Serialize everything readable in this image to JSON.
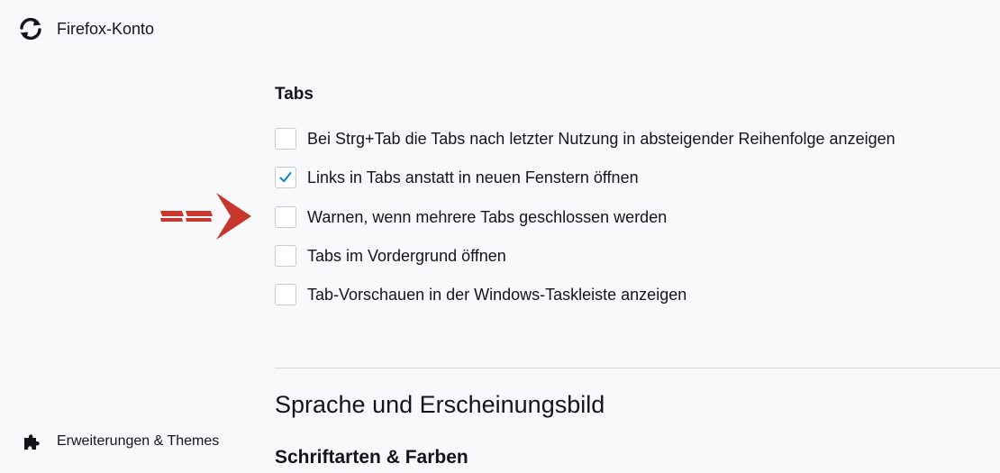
{
  "sidebar": {
    "account_label": "Firefox-Konto",
    "account_icon": "sync-icon",
    "extensions_label": "Erweiterungen & Themes",
    "extensions_icon": "puzzle-icon"
  },
  "tabs_section": {
    "title": "Tabs",
    "options": [
      {
        "label": "Bei Strg+Tab die Tabs nach letzter Nutzung in absteigender Reihenfolge anzeigen",
        "checked": false
      },
      {
        "label": "Links in Tabs anstatt in neuen Fenstern öffnen",
        "checked": true
      },
      {
        "label": "Warnen, wenn mehrere Tabs geschlossen werden",
        "checked": false
      },
      {
        "label": "Tabs im Vordergrund öffnen",
        "checked": false
      },
      {
        "label": "Tab-Vorschauen in der Windows-Taskleiste anzeigen",
        "checked": false
      }
    ]
  },
  "language_section": {
    "title": "Sprache und Erscheinungsbild",
    "fonts_title": "Schriftarten & Farben"
  },
  "colors": {
    "background": "#f9f9fb",
    "checkmark": "#0a84c6",
    "annotation_arrow": "#c8372d"
  }
}
